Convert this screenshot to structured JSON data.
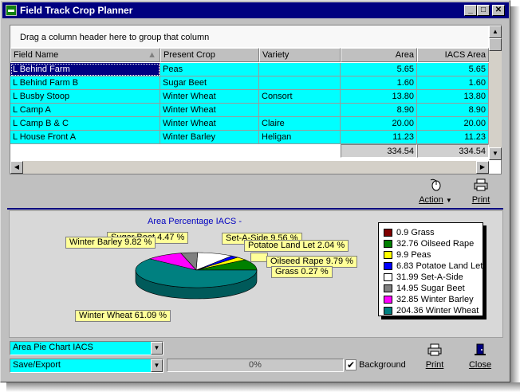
{
  "window": {
    "title": "Field Track Crop Planner"
  },
  "grid": {
    "group_hint": "Drag a column header here to group that column",
    "columns": [
      "Field Name",
      "Present Crop",
      "Variety",
      "Area",
      "IACS Area"
    ],
    "rows": [
      [
        "L Behind Farm",
        "Peas",
        "",
        "5.65",
        "5.65"
      ],
      [
        "L Behind Farm B",
        "Sugar Beet",
        "",
        "1.60",
        "1.60"
      ],
      [
        "L Busby Stoop",
        "Winter Wheat",
        "Consort",
        "13.80",
        "13.80"
      ],
      [
        "L Camp A",
        "Winter Wheat",
        "",
        "8.90",
        "8.90"
      ],
      [
        "L Camp B & C",
        "Winter Wheat",
        "Claire",
        "20.00",
        "20.00"
      ],
      [
        "L House Front A",
        "Winter Barley",
        "Heligan",
        "11.23",
        "11.23"
      ]
    ],
    "totals": {
      "area": "334.54",
      "iacs_area": "334.54"
    }
  },
  "toolbar": {
    "action_label": "Action",
    "print_label": "Print"
  },
  "chart_data": {
    "type": "pie",
    "title": "Area Percentage IACS -",
    "series": [
      {
        "name": "Grass",
        "value": 0.9,
        "percent_label": "Grass 0.27 %",
        "color": "#800000"
      },
      {
        "name": "Oilseed Rape",
        "value": 32.76,
        "percent_label": "Oilseed Rape 9.79 %",
        "color": "#008000"
      },
      {
        "name": "Peas",
        "value": 9.9,
        "percent_label": "",
        "color": "#ffff00"
      },
      {
        "name": "Potatoe Land Let",
        "value": 6.83,
        "percent_label": "Potatoe Land Let 2.04 %",
        "color": "#0000ff"
      },
      {
        "name": "Set-A-Side",
        "value": 31.99,
        "percent_label": "Set-A-Side 9.56 %",
        "color": "#ffffff"
      },
      {
        "name": "Sugar Beet",
        "value": 14.95,
        "percent_label": "Sugar Beet 4.47 %",
        "color": "#808080"
      },
      {
        "name": "Winter Barley",
        "value": 32.85,
        "percent_label": "Winter Barley 9.82 %",
        "color": "#ff00ff"
      },
      {
        "name": "Winter Wheat",
        "value": 204.36,
        "percent_label": "Winter Wheat 61.09 %",
        "color": "#008080"
      }
    ],
    "legend": [
      "0.9 Grass",
      "32.76 Oilseed Rape",
      "9.9 Peas",
      "6.83 Potatoe Land Let",
      "31.99 Set-A-Side",
      "14.95 Sugar Beet",
      "32.85 Winter Barley",
      "204.36 Winter Wheat"
    ],
    "legend_position": "right",
    "style": "3d-pie"
  },
  "bottom": {
    "chart_select": "Area Pie Chart IACS",
    "export_select": "Save/Export",
    "progress_text": "0%",
    "progress_value": 0,
    "background_label": "Background",
    "background_checked": true,
    "print_label": "Print",
    "close_label": "Close"
  }
}
